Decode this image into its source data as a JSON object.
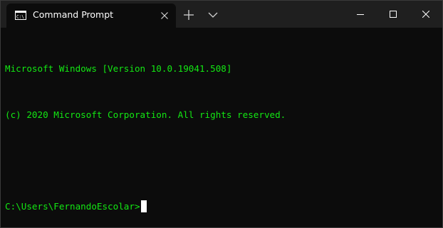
{
  "window": {
    "tab_title": "Command Prompt",
    "tab_icon": "cmd-icon",
    "controls": {
      "new_tab_icon": "plus-icon",
      "dropdown_icon": "chevron-down-icon",
      "minimize_icon": "minimize-icon",
      "maximize_icon": "maximize-icon",
      "close_icon": "close-icon"
    }
  },
  "terminal": {
    "lines": [
      "Microsoft Windows [Version 10.0.19041.508]",
      "(c) 2020 Microsoft Corporation. All rights reserved.",
      "",
      "C:\\Users\\FernandoEscolar>"
    ],
    "text_color": "#13e813",
    "background_color": "#0c0c0c"
  }
}
